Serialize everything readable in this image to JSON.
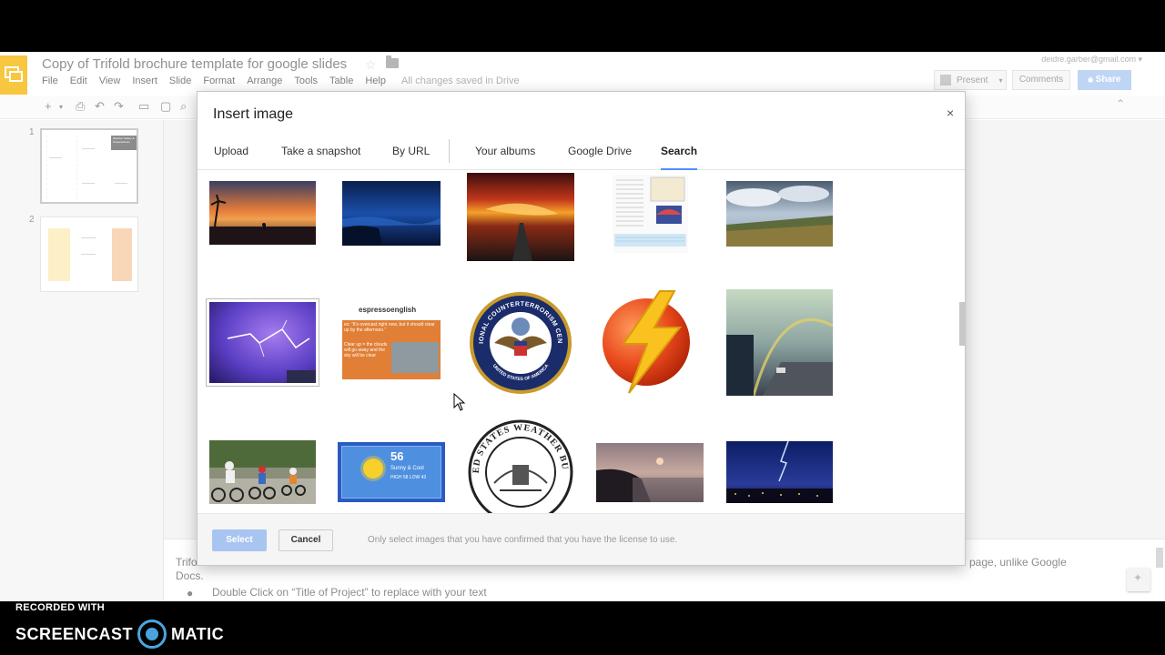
{
  "app": {
    "title": "Copy of Trifold brochure template for google slides",
    "account": "deidre.garber@gmail.com ▾",
    "menu": [
      "File",
      "Edit",
      "View",
      "Insert",
      "Slide",
      "Format",
      "Arrange",
      "Tools",
      "Table",
      "Help"
    ],
    "save_status": "All changes saved in Drive",
    "present_label": "Present",
    "comments_label": "Comments",
    "share_label": "Share",
    "slides": [
      {
        "number": "1"
      },
      {
        "number": "2"
      }
    ],
    "thumb1_header": "Weather Safety & Preparedness",
    "notes_line1_left": "Trifo",
    "notes_line1_right": "page, unlike Google",
    "notes_line2": "Docs.",
    "notes_bullet": "Double Click on “Title of Project” to replace with your text"
  },
  "dialog": {
    "title": "Insert image",
    "close": "×",
    "tabs": [
      "Upload",
      "Take a snapshot",
      "By URL",
      "Your albums",
      "Google Drive",
      "Search"
    ],
    "active_tab": "Search",
    "select_label": "Select",
    "cancel_label": "Cancel",
    "license_note": "Only select images that you have confirmed that you have the license to use."
  },
  "images": [
    {
      "name": "sunset-palm-beach-image",
      "desc": "sunset palm beach"
    },
    {
      "name": "blue-night-lake-image",
      "desc": "blue night lake"
    },
    {
      "name": "fiery-sky-road-image",
      "desc": "fiery sky road"
    },
    {
      "name": "document-page-image",
      "desc": "document page"
    },
    {
      "name": "cloudy-coast-image",
      "desc": "cloudy coast"
    },
    {
      "name": "purple-lightning-image",
      "desc": "purple lightning"
    },
    {
      "name": "espresso-english-image",
      "desc": "espresso english",
      "brand": "espressoenglish",
      "caption": "ex: “It’s overcast right now, but it should clear up by the afternoon.”",
      "caption2": "Clear up = the clouds will go away and the sky will be clear"
    },
    {
      "name": "counterterrorism-seal-image",
      "desc": "counterterrorism seal",
      "text_top": "NATIONAL COUNTERTERRORISM CENTER",
      "text_bottom": "UNITED STATES OF AMERICA"
    },
    {
      "name": "lightning-bolt-icon-image",
      "desc": "lightning bolt icon"
    },
    {
      "name": "rainbow-street-image",
      "desc": "rainbow street"
    },
    {
      "name": "kids-bikes-image",
      "desc": "kids on bikes"
    },
    {
      "name": "weather-widget-image",
      "desc": "weather widget",
      "temp": "56",
      "line1": "Sunny & Cool",
      "line2": "HIGH 58 LOW 43"
    },
    {
      "name": "weather-bureau-seal-image",
      "desc": "weather bureau seal",
      "ring_text": "UNITED STATES WEATHER BUREAU"
    },
    {
      "name": "dusk-shore-image",
      "desc": "dusk shore"
    },
    {
      "name": "night-lightning-city-image",
      "desc": "night lightning city"
    }
  ],
  "colors": {
    "accent": "#4d90fe",
    "logo": "#f4b400",
    "share": "#a8c7f0"
  },
  "watermark": {
    "line1": "RECORDED WITH",
    "word1": "SCREENCAST",
    "word2": "MATIC"
  }
}
